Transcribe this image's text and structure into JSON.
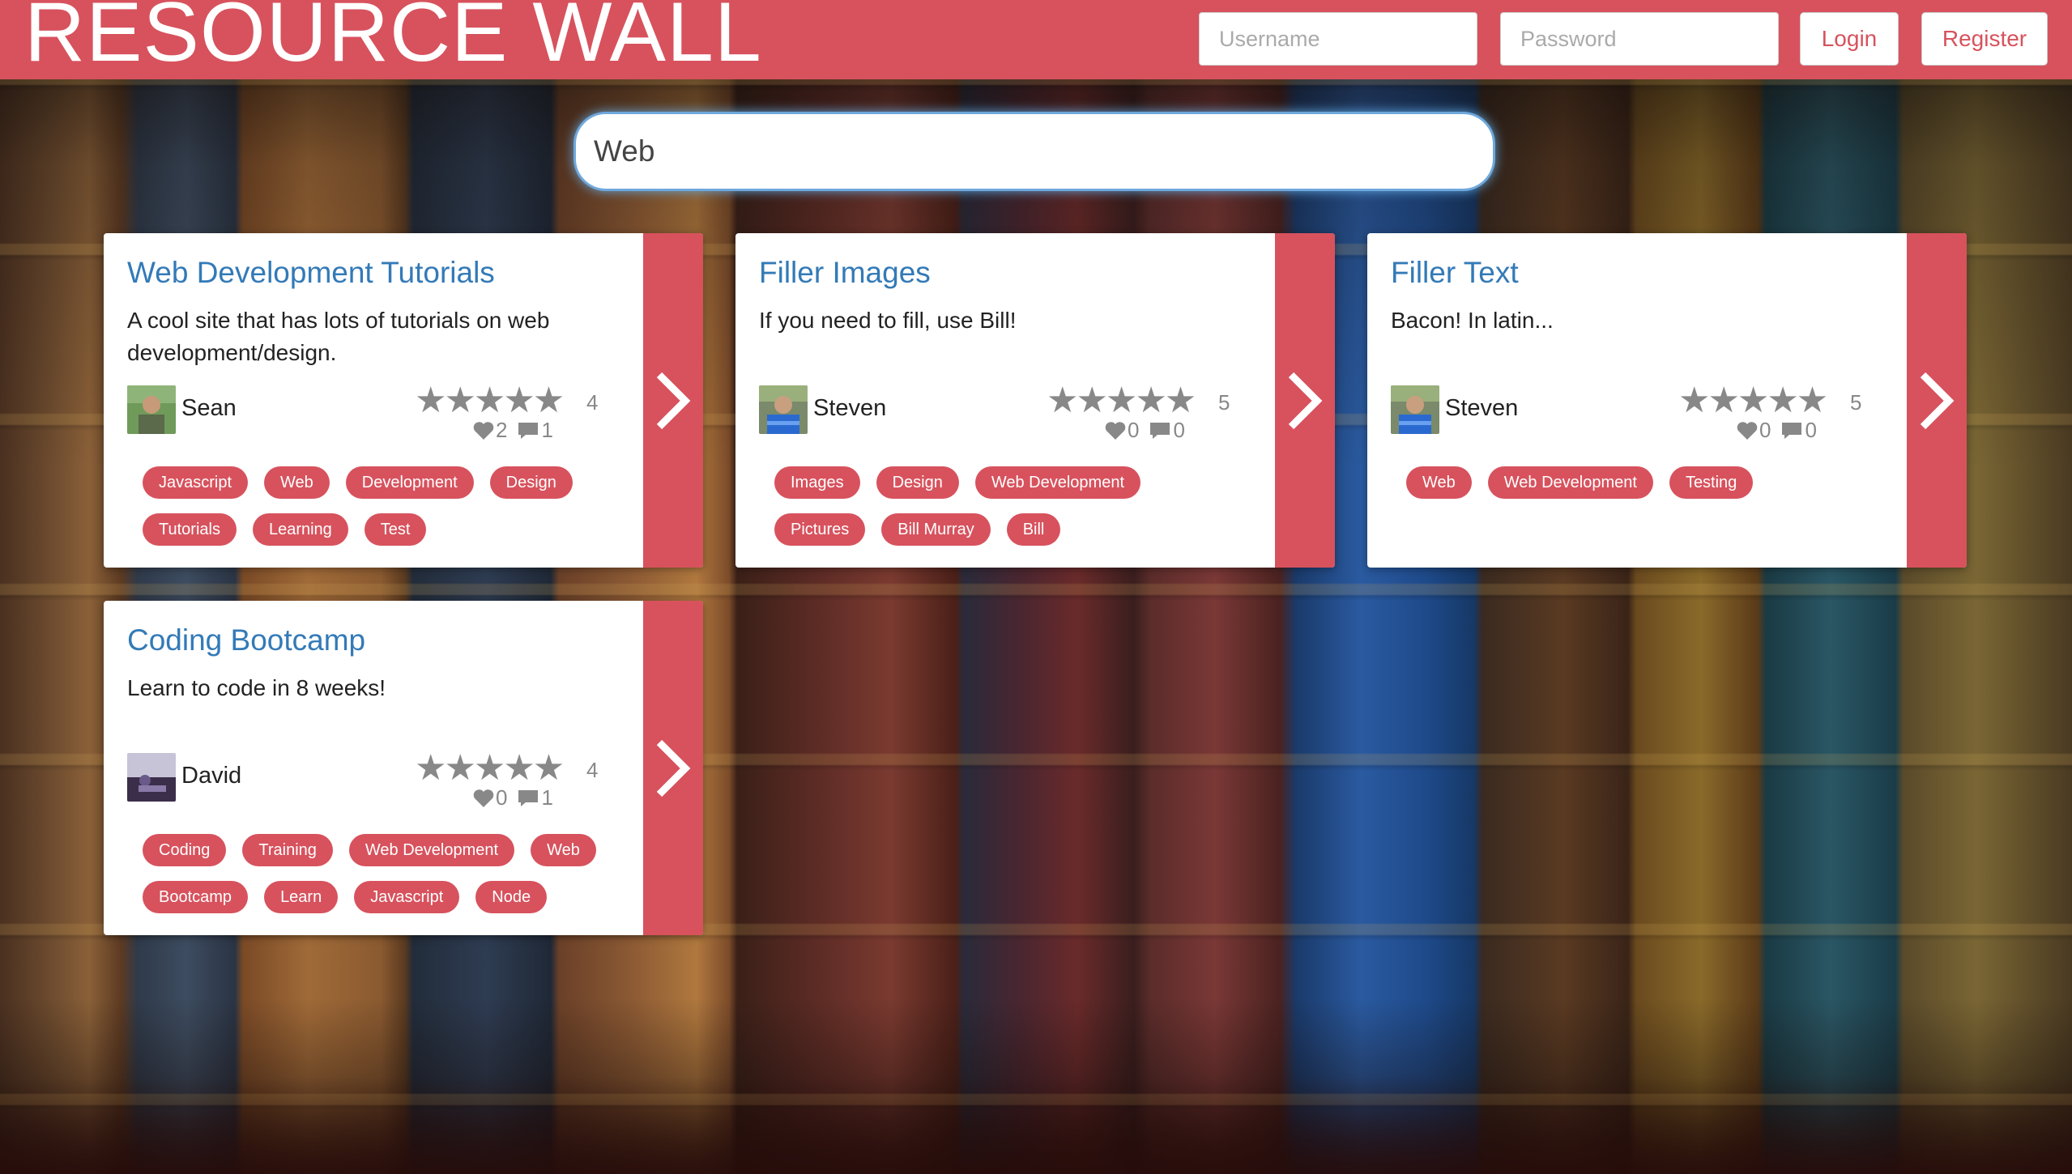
{
  "header": {
    "logo": "RESOURCE WALL",
    "username_placeholder": "Username",
    "password_placeholder": "Password",
    "login_label": "Login",
    "register_label": "Register"
  },
  "search": {
    "value": "Web"
  },
  "colors": {
    "accent": "#d7525d",
    "link": "#337ab7",
    "muted": "#888888"
  },
  "cards": [
    {
      "title": "Web Development Tutorials",
      "description": "A cool site that has lots of tutorials on web development/design.",
      "author": "Sean",
      "rating": "4",
      "likes": "2",
      "comments": "1",
      "tags": [
        "Javascript",
        "Web",
        "Development",
        "Design",
        "Tutorials",
        "Learning",
        "Test"
      ]
    },
    {
      "title": "Filler Images",
      "description": "If you need to fill, use Bill!",
      "author": "Steven",
      "rating": "5",
      "likes": "0",
      "comments": "0",
      "tags": [
        "Images",
        "Design",
        "Web Development",
        "Pictures",
        "Bill Murray",
        "Bill"
      ]
    },
    {
      "title": "Filler Text",
      "description": "Bacon! In latin...",
      "author": "Steven",
      "rating": "5",
      "likes": "0",
      "comments": "0",
      "tags": [
        "Web",
        "Web Development",
        "Testing"
      ]
    },
    {
      "title": "Coding Bootcamp",
      "description": "Learn to code in 8 weeks!",
      "author": "David",
      "rating": "4",
      "likes": "0",
      "comments": "1",
      "tags": [
        "Coding",
        "Training",
        "Web Development",
        "Web",
        "Bootcamp",
        "Learn",
        "Javascript",
        "Node"
      ]
    }
  ]
}
